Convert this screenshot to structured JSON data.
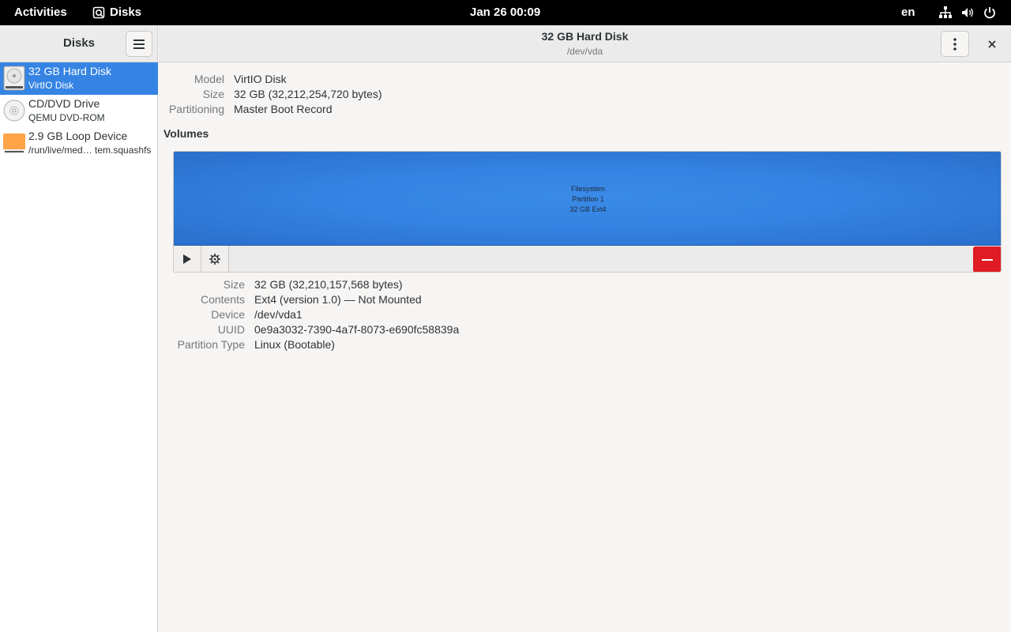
{
  "topbar": {
    "activities": "Activities",
    "app_name": "Disks",
    "clock": "Jan 26  00:09",
    "lang": "en",
    "tray_icons": [
      "network-icon",
      "volume-icon",
      "power-icon"
    ]
  },
  "sidebar": {
    "title": "Disks",
    "disks": [
      {
        "name": "32 GB Hard Disk",
        "sub": "VirtIO Disk",
        "icon": "hard-disk-icon",
        "selected": true
      },
      {
        "name": "CD/DVD Drive",
        "sub": "QEMU DVD-ROM",
        "icon": "optical-drive-icon",
        "selected": false
      },
      {
        "name": "2.9 GB Loop Device",
        "sub": "/run/live/med… tem.squashfs",
        "icon": "loop-device-icon",
        "selected": false
      }
    ]
  },
  "header": {
    "title": "32 GB Hard Disk",
    "subtitle": "/dev/vda"
  },
  "disk_info": {
    "model_label": "Model",
    "model": "VirtIO Disk",
    "size_label": "Size",
    "size": "32 GB (32,212,254,720 bytes)",
    "partitioning_label": "Partitioning",
    "partitioning": "Master Boot Record"
  },
  "volumes": {
    "heading": "Volumes",
    "partition": {
      "line1": "Filesystem",
      "line2": "Partition 1",
      "line3": "32 GB Ext4"
    }
  },
  "volume_info": {
    "size_label": "Size",
    "size": "32 GB (32,210,157,568 bytes)",
    "contents_label": "Contents",
    "contents": "Ext4 (version 1.0) — Not Mounted",
    "device_label": "Device",
    "device": "/dev/vda1",
    "uuid_label": "UUID",
    "uuid": "0e9a3032-7390-4a7f-8073-e690fc58839a",
    "ptype_label": "Partition Type",
    "ptype": "Linux (Bootable)"
  },
  "colors": {
    "accent": "#3584e4",
    "destructive": "#e01b24"
  }
}
